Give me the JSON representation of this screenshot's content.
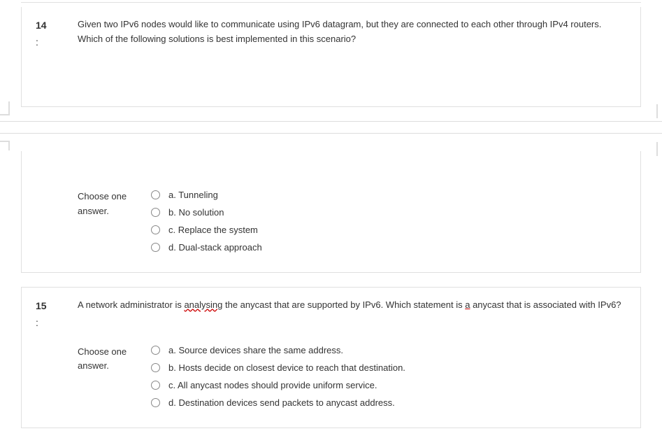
{
  "q14": {
    "number": "14",
    "colon": ":",
    "text": "Given two IPv6 nodes would like to communicate using IPv6 datagram, but they are connected to each other through IPv4 routers. Which of the following solutions is best implemented in this scenario?",
    "choose_label": "Choose one answer.",
    "options": {
      "a": "a. Tunneling",
      "b": "b. No solution",
      "c": "c. Replace the system",
      "d": "d. Dual-stack approach"
    }
  },
  "q15": {
    "number": "15",
    "colon": ":",
    "text_pre": "A network administrator is ",
    "text_analysing": "analysing",
    "text_mid": " the anycast that are supported by IPv6. Which statement is ",
    "text_a": "a",
    "text_post": " anycast that is associated with IPv6?",
    "choose_label": "Choose one answer.",
    "options": {
      "a": "a. Source devices share the same address.",
      "b": "b. Hosts decide on closest device to reach that destination.",
      "c": "c. All anycast nodes should provide uniform service.",
      "d": "d. Destination devices send packets to anycast address."
    }
  }
}
